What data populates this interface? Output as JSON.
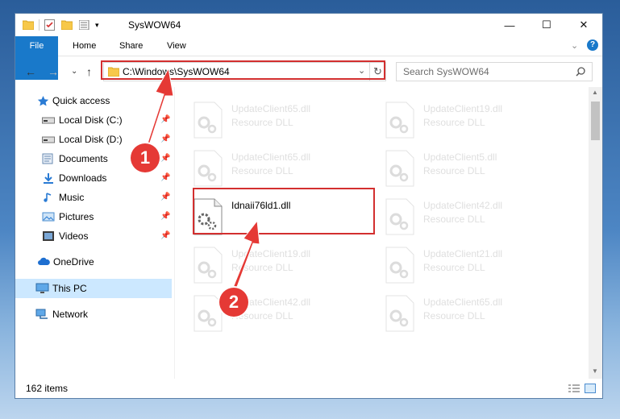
{
  "window": {
    "title": "SysWOW64",
    "min_glyph": "—",
    "max_glyph": "☐",
    "close_glyph": "✕"
  },
  "ribbon": {
    "tabs": [
      "File",
      "Home",
      "Share",
      "View"
    ]
  },
  "nav": {
    "back_glyph": "←",
    "forward_glyph": "→",
    "recent_glyph": "⌄",
    "up_glyph": "↑"
  },
  "address": {
    "path": "C:\\Windows\\SysWOW64"
  },
  "search": {
    "placeholder": "Search SysWOW64"
  },
  "sidebar": {
    "items": [
      {
        "label": "Quick access",
        "icon": "star-icon",
        "pinned": false
      },
      {
        "label": "Local Disk (C:)",
        "icon": "drive-icon",
        "pinned": true
      },
      {
        "label": "Local Disk (D:)",
        "icon": "drive-icon",
        "pinned": true
      },
      {
        "label": "Documents",
        "icon": "documents-icon",
        "pinned": true
      },
      {
        "label": "Downloads",
        "icon": "downloads-icon",
        "pinned": true
      },
      {
        "label": "Music",
        "icon": "music-icon",
        "pinned": true
      },
      {
        "label": "Pictures",
        "icon": "pictures-icon",
        "pinned": true
      },
      {
        "label": "Videos",
        "icon": "videos-icon",
        "pinned": true
      },
      {
        "label": "OneDrive",
        "icon": "cloud-icon",
        "pinned": false
      },
      {
        "label": "This PC",
        "icon": "computer-icon",
        "pinned": false,
        "selected": true
      },
      {
        "label": "Network",
        "icon": "network-icon",
        "pinned": false
      }
    ]
  },
  "files": [
    {
      "name": "UpdateClient65.dll",
      "type": "Resource DLL",
      "faded": true
    },
    {
      "name": "UpdateClient19.dll",
      "type": "Resource DLL",
      "faded": true
    },
    {
      "name": "UpdateClient65.dll",
      "type": "Resource DLL",
      "faded": true
    },
    {
      "name": "UpdateClient5.dll",
      "type": "Resource DLL",
      "faded": true
    },
    {
      "name": "Idnaii76ld1.dll",
      "type": "",
      "faded": false
    },
    {
      "name": "UpdateClient42.dll",
      "type": "Resource DLL",
      "faded": true
    },
    {
      "name": "UpdateClient19.dll",
      "type": "Resource DLL",
      "faded": true
    },
    {
      "name": "UpdateClient21.dll",
      "type": "Resource DLL",
      "faded": true
    },
    {
      "name": "UpdateClient42.dll",
      "type": "Resource DLL",
      "faded": true
    },
    {
      "name": "UpdateClient65.dll",
      "type": "Resource DLL",
      "faded": true
    }
  ],
  "status": {
    "item_count": "162 items"
  },
  "annotations": {
    "step1": "1",
    "step2": "2",
    "color": "#d32f2f"
  }
}
